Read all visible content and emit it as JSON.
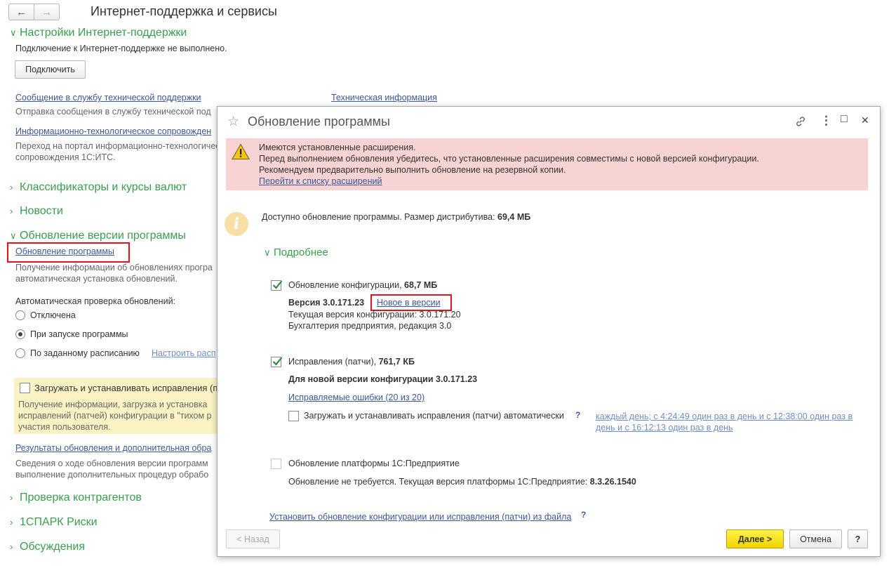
{
  "nav": {
    "back_glyph": "←",
    "forward_glyph": "→"
  },
  "page_title": "Интернет-поддержка и сервисы",
  "sections": {
    "support_settings": {
      "title": "Настройки Интернет-поддержки",
      "status": "Подключение к Интернет-поддержке не выполнено.",
      "connect_label": "Подключить",
      "message_link": "Сообщение в службу технической поддержки",
      "message_desc": "Отправка сообщения в службу технической под",
      "tech_info_link": "Техническая информация",
      "its_link": "Информационно-технологическое сопровожден",
      "its_desc_1": "Переход на портал информационно-технологичес",
      "its_desc_2": "сопровождения 1С:ИТС."
    },
    "classifiers": "Классификаторы и курсы валют",
    "news": "Новости",
    "version_update": {
      "title": "Обновление версии программы",
      "update_link": "Обновление программы",
      "desc_1": "Получение информации об обновлениях програ",
      "desc_2": "автоматическая установка обновлений.",
      "auto_check_label": "Автоматическая проверка обновлений:",
      "radio_off": "Отключена",
      "radio_startup": "При запуске программы",
      "radio_schedule": "По заданному расписанию",
      "schedule_link": "Настроить расп",
      "patches_label": "Загружать и устанавливать исправления (п",
      "patches_desc_1": "Получение информации, загрузка и установка",
      "patches_desc_2": "исправлений (патчей) конфигурации в \"тихом р",
      "patches_desc_3": "участия пользователя.",
      "results_link": "Результаты обновления и дополнительная обра",
      "results_desc_1": "Сведения о ходе обновления версии программ",
      "results_desc_2": "выполнение дополнительных процедур обрабо"
    },
    "counterparties": "Проверка контрагентов",
    "spark": "1СПАРК Риски",
    "discussions": "Обсуждения"
  },
  "dialog": {
    "title": "Обновление программы",
    "icons": {
      "star": "☆",
      "link": "link-icon",
      "more": "⋮",
      "maximize": "□",
      "close": "✕"
    },
    "warning": {
      "line1": "Имеются установленные расширения.",
      "line2": "Перед выполнением обновления убедитесь, что установленные расширения совместимы с новой версией конфигурации.",
      "line3": "Рекомендуем предварительно выполнить обновление на резервной копии.",
      "link": "Перейти к списку расширений"
    },
    "available_prefix": "Доступно обновление программы. Размер дистрибутива:",
    "available_size": "69,4 МБ",
    "details_label": "Подробнее",
    "config": {
      "label": "Обновление конфигурации,",
      "size": "68,7 МБ",
      "version_label": "Версия 3.0.171.23",
      "whats_new": "Новое в версии",
      "current": "Текущая версия конфигурации: 3.0.171.20",
      "edition": "Бухгалтерия предприятия, редакция 3.0"
    },
    "patches": {
      "label": "Исправления (патчи),",
      "size": "761,7 КБ",
      "for_version": "Для новой версии конфигурации 3.0.171.23",
      "fixed_errors": "Исправляемые ошибки (20 из 20)",
      "auto_label": "Загружать и устанавливать исправления (патчи) автоматически",
      "help": "?",
      "schedule_1": "каждый день; с 4:24:49 один раз в день и с 12:38:00 один раз в",
      "schedule_2": "день и с 16:12:13 один раз в день"
    },
    "platform": {
      "label": "Обновление платформы 1С:Предприятие",
      "status_prefix": "Обновление не требуется. Текущая версия платформы 1С:Предприятие:",
      "version": "8.3.26.1540"
    },
    "install_from_file": "Установить обновление конфигурации или исправления (патчи) из файла",
    "install_help": "?",
    "buttons": {
      "back": "< Назад",
      "next": "Далее >",
      "cancel": "Отмена",
      "help": "?"
    }
  }
}
